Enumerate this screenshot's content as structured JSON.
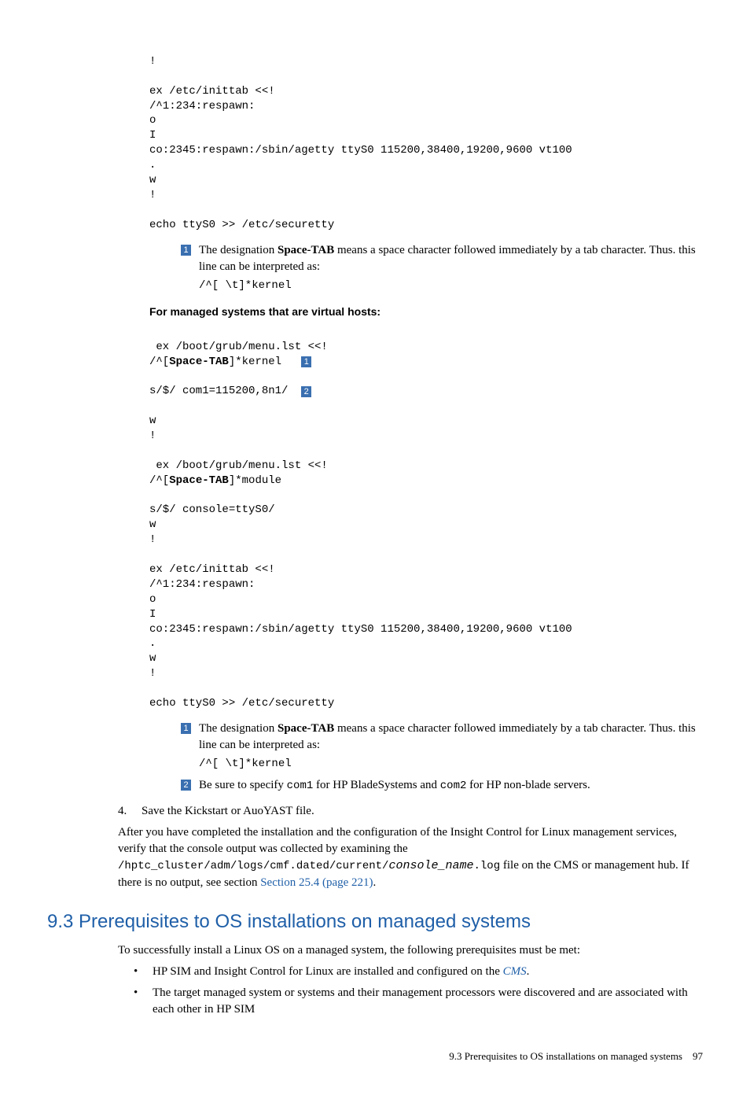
{
  "code1": {
    "l1": "!",
    "l2": "",
    "l3": "ex /etc/inittab <<!",
    "l4": "/^1:234:respawn:",
    "l5": "o",
    "l6": "I",
    "l7": "co:2345:respawn:/sbin/agetty ttyS0 115200,38400,19200,9600 vt100",
    "l8": ".",
    "l9": "w",
    "l10": "!",
    "l11": "",
    "l12": "echo ttyS0 >> /etc/securetty"
  },
  "note1": {
    "num": "1",
    "text_pre": "The designation ",
    "text_bold": "Space-TAB",
    "text_post": " means a space character followed immediately by a tab character. Thus. this line can be interpreted as:",
    "code": "/^[ \\t]*kernel"
  },
  "subhead1": "For managed systems that are virtual hosts:",
  "code2": {
    "l1": " ex /boot/grub/menu.lst <<!",
    "l2a": "/^[",
    "l2b": "Space-TAB",
    "l2c": "]*kernel   ",
    "l2num": "1",
    "l3a": "s/$/ com1=115200,8n1/  ",
    "l3num": "2",
    "l4": "w",
    "l5": "!",
    "l6": "",
    "l7": " ex /boot/grub/menu.lst <<!",
    "l8a": "/^[",
    "l8b": "Space-TAB",
    "l8c": "]*module",
    "l9": "s/$/ console=ttyS0/",
    "l10": "w",
    "l11": "!",
    "l12": "",
    "l13": "ex /etc/inittab <<!",
    "l14": "/^1:234:respawn:",
    "l15": "o",
    "l16": "I",
    "l17": "co:2345:respawn:/sbin/agetty ttyS0 115200,38400,19200,9600 vt100",
    "l18": ".",
    "l19": "w",
    "l20": "!",
    "l21": "",
    "l22": "echo ttyS0 >> /etc/securetty"
  },
  "note2a": {
    "num": "1",
    "text_pre": "The designation ",
    "text_bold": "Space-TAB",
    "text_post": " means a space character followed immediately by a tab character. Thus. this line can be interpreted as:",
    "code": "/^[ \\t]*kernel"
  },
  "note2b": {
    "num": "2",
    "t1": "Be sure to specify ",
    "c1": "com1",
    "t2": " for HP BladeSystems and ",
    "c2": "com2",
    "t3": " for HP non-blade servers."
  },
  "step4": {
    "num": "4.",
    "text": "Save the Kickstart or AuoYAST file."
  },
  "para_after": {
    "t1": "After you have completed the installation and the configuration of the Insight Control for Linux management services, verify that the console output was collected by examining the ",
    "c1": "/hptc_cluster/adm/logs/cmf.dated/current/",
    "c2": "console_name",
    "c3": ".log",
    "t2": " file on the CMS or management hub. If there is no output, see section ",
    "link": "Section 25.4 (page 221)",
    "t3": "."
  },
  "section_heading": "9.3 Prerequisites to OS installations on managed systems",
  "section_intro": "To successfully install a Linux OS on a managed system, the following prerequisites must be met:",
  "bullets": {
    "b1a": "HP SIM and Insight Control for Linux are installed and configured on the ",
    "b1link": "CMS",
    "b1b": ".",
    "b2": "The target managed system or systems and their management processors were discovered and are associated with each other in HP SIM"
  },
  "footer": {
    "text": "9.3 Prerequisites to OS installations on managed systems",
    "page": "97"
  }
}
